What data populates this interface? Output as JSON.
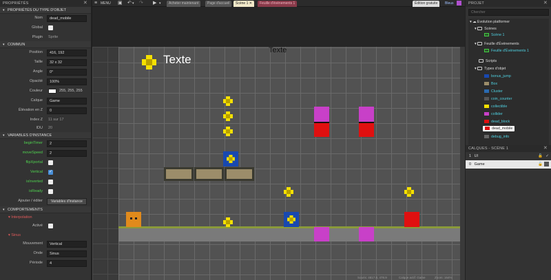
{
  "left_panel": {
    "title": "PROPRIÉTÉS",
    "sec_object_type": "PROPRIÉTÉS DU TYPE D'OBJET",
    "name_label": "Nom",
    "name_value": "dead_mobile",
    "global_label": "Global",
    "plugin_label": "Plugin",
    "plugin_value": "Sprite",
    "sec_common": "COMMUN",
    "position_label": "Position",
    "position_value": "416, 192",
    "size_label": "Taille",
    "size_value": "32 x 32",
    "angle_label": "Angle",
    "angle_value": "0°",
    "opacity_label": "Opacité",
    "opacity_value": "100%",
    "color_label": "Couleur",
    "color_value": "255, 255, 255",
    "layer_label": "Calque",
    "layer_value": "Game",
    "elevation_label": "Élévation en Z",
    "elevation_value": "0",
    "zindex_label": "Index Z",
    "zindex_value": "11 sur 17",
    "uid_label": "IDU",
    "uid_value": "20",
    "sec_instance_vars": "VARIABLES D'INSTANCE",
    "vars": [
      {
        "label": "beginTimer",
        "value": "2"
      },
      {
        "label": "moveSpeed",
        "value": "2"
      }
    ],
    "bools": [
      {
        "label": "flipXportal"
      },
      {
        "label": "Vertical"
      },
      {
        "label": "isInverted"
      },
      {
        "label": "isReady"
      }
    ],
    "add_edit_label": "Ajouter / éditer",
    "instance_vars_button": "Variables d'instance",
    "sec_behaviors": "COMPORTEMENTS",
    "interp_label": "Interpolation",
    "active_label": "Activé",
    "sine_label": "Sinus",
    "movement_label": "Mouvement",
    "movement_value": "Vertical",
    "wave_label": "Onde",
    "wave_value": "Sinus",
    "period_label": "Période",
    "period_value": "4"
  },
  "toolbar": {
    "menu": "MENU",
    "tabs": [
      "Acheter maintenant",
      "Page d'accueil",
      "Scène 1",
      "Feuille d'événements 1"
    ],
    "free_edition": "Édition gratuite",
    "login": "Bleus"
  },
  "scene": {
    "text_object": "Texte",
    "top_label": "Texte"
  },
  "right_panel": {
    "title": "PROJET",
    "search_placeholder": "Chercher",
    "project_name": "Evolution platformer",
    "scenes": "Scènes",
    "scene1": "Scène 1",
    "event_sheets": "Feuille d'Événements",
    "event_sheet1": "Feuille d'Événements 1",
    "scripts": "Scripts",
    "object_types": "Types d'objet",
    "objects": [
      "bonus_jump",
      "Box",
      "Cluster",
      "coin_counter",
      "collectible",
      "collider",
      "dead_block",
      "dead_mobile",
      "debug_info"
    ],
    "layers_title": "CALQUES - SCÈNE 1",
    "layers": [
      {
        "index": "1",
        "name": "UI"
      },
      {
        "index": "0",
        "name": "Game"
      }
    ]
  },
  "status": {
    "mouse": "Souris: 4817.8, 478.9",
    "active_layer": "Calque actif: Game",
    "zoom": "Zoom: 164%"
  }
}
